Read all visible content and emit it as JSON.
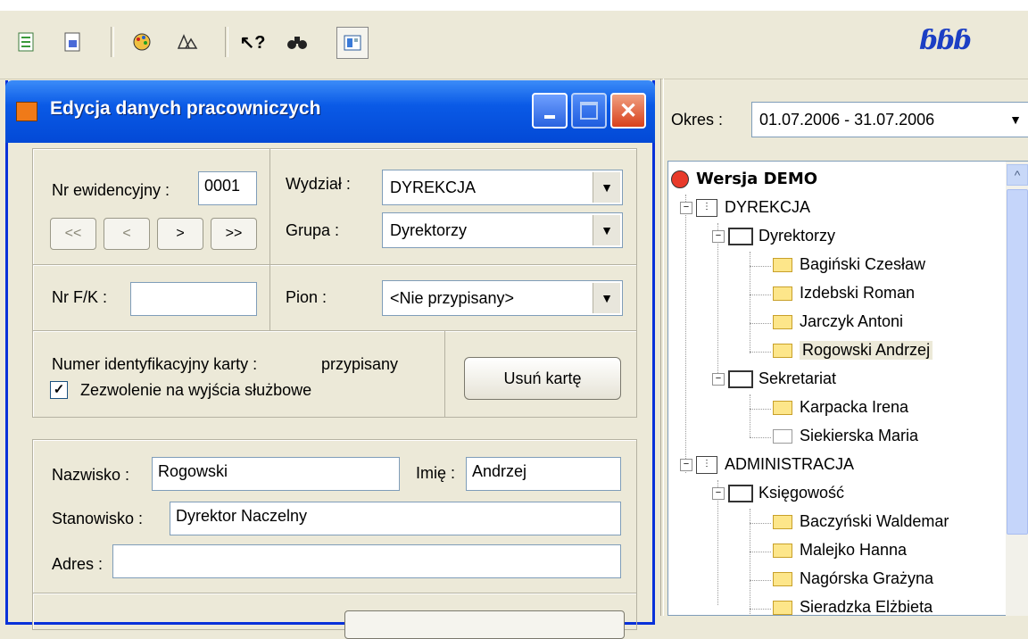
{
  "toolbar": {
    "icons": [
      "report-icon",
      "document-import-icon",
      "palette-icon",
      "bell-icon",
      "help-pointer-icon",
      "binoculars-icon",
      "grid-view-icon"
    ],
    "logo": "ɓɓɓ"
  },
  "dialog": {
    "title": "Edycja danych pracowniczych",
    "nr_ewidencyjny_label": "Nr ewidencyjny :",
    "nr_ewidencyjny_value": "0001",
    "nav": [
      "<<",
      "<",
      ">",
      ">>"
    ],
    "wydzial_label": "Wydział :",
    "wydzial_value": "DYREKCJA",
    "grupa_label": "Grupa :",
    "grupa_value": "Dyrektorzy",
    "nrfk_label": "Nr F/K :",
    "nrfk_value": "",
    "pion_label": "Pion :",
    "pion_value": "<Nie przypisany>",
    "card_label": "Numer identyfikacyjny karty :",
    "card_value": "przypisany",
    "remove_card": "Usuń kartę",
    "exit_permission_label": "Zezwolenie na wyjścia służbowe",
    "exit_permission_checked": true,
    "nazwisko_label": "Nazwisko :",
    "nazwisko_value": "Rogowski",
    "imie_label": "Imię :",
    "imie_value": "Andrzej",
    "stanowisko_label": "Stanowisko :",
    "stanowisko_value": "Dyrektor Naczelny",
    "adres_label": "Adres :",
    "adres_value": ""
  },
  "period": {
    "label": "Okres :",
    "value": "01.07.2006 - 31.07.2006"
  },
  "tree": {
    "root": "Wersja DEMO",
    "dept1": "DYREKCJA",
    "dept1_group1": "Dyrektorzy",
    "dept1_group1_people": [
      "Bagiński Czesław",
      "Izdebski Roman",
      "Jarczyk Antoni",
      "Rogowski Andrzej"
    ],
    "dept1_group2": "Sekretariat",
    "dept1_group2_people": [
      "Karpacka Irena",
      "Siekierska Maria"
    ],
    "dept2": "ADMINISTRACJA",
    "dept2_group1": "Księgowość",
    "dept2_group1_people": [
      "Baczyński Waldemar",
      "Malejko Hanna",
      "Nagórska Grażyna",
      "Sieradzka Elżbieta"
    ],
    "selected": "Rogowski Andrzej"
  },
  "colors": {
    "titlebar": "#0a5ae6",
    "window_bg": "#ece9d8",
    "logo": "#1c3fc4"
  }
}
